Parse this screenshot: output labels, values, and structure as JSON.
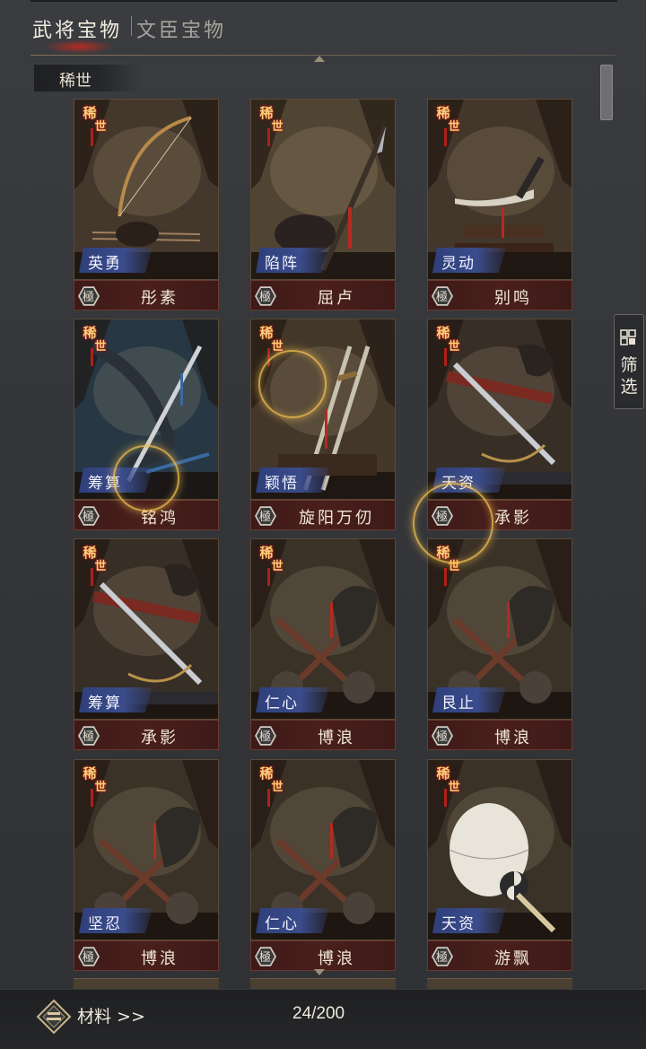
{
  "tabs": {
    "active": "武将宝物",
    "inactive": "文臣宝物"
  },
  "section": "稀世",
  "filter": {
    "label_1": "筛",
    "label_2": "选"
  },
  "rarity_label": [
    "稀",
    "世"
  ],
  "grade_label": "極",
  "items": [
    {
      "tag": "英勇",
      "name": "彤素",
      "art": "bow",
      "sky": "#5b4a3a"
    },
    {
      "tag": "陷阵",
      "name": "屈卢",
      "art": "spear",
      "sky": "#6b5b45"
    },
    {
      "tag": "灵动",
      "name": "别鸣",
      "art": "dagger",
      "sky": "#5a4838"
    },
    {
      "tag": "筹算",
      "name": "铭鸿",
      "art": "sword-dragon",
      "sky": "#344a5a"
    },
    {
      "tag": "颖悟",
      "name": "旋阳万仞",
      "art": "twin-swords",
      "sky": "#5a4a38"
    },
    {
      "tag": "天资",
      "name": "承影",
      "art": "sword-horse",
      "sky": "#4a3e33"
    },
    {
      "tag": "筹算",
      "name": "承影",
      "art": "sword-horse",
      "sky": "#4a3e33"
    },
    {
      "tag": "仁心",
      "name": "博浪",
      "art": "maces",
      "sky": "#4e4234"
    },
    {
      "tag": "艮止",
      "name": "博浪",
      "art": "maces",
      "sky": "#4e4234"
    },
    {
      "tag": "坚忍",
      "name": "博浪",
      "art": "maces",
      "sky": "#4e4234"
    },
    {
      "tag": "仁心",
      "name": "博浪",
      "art": "maces",
      "sky": "#4e4234"
    },
    {
      "tag": "天资",
      "name": "游飘",
      "art": "fan",
      "sky": "#4e4234"
    }
  ],
  "bottom": {
    "materials": "材料 >>",
    "count": "24/200"
  }
}
